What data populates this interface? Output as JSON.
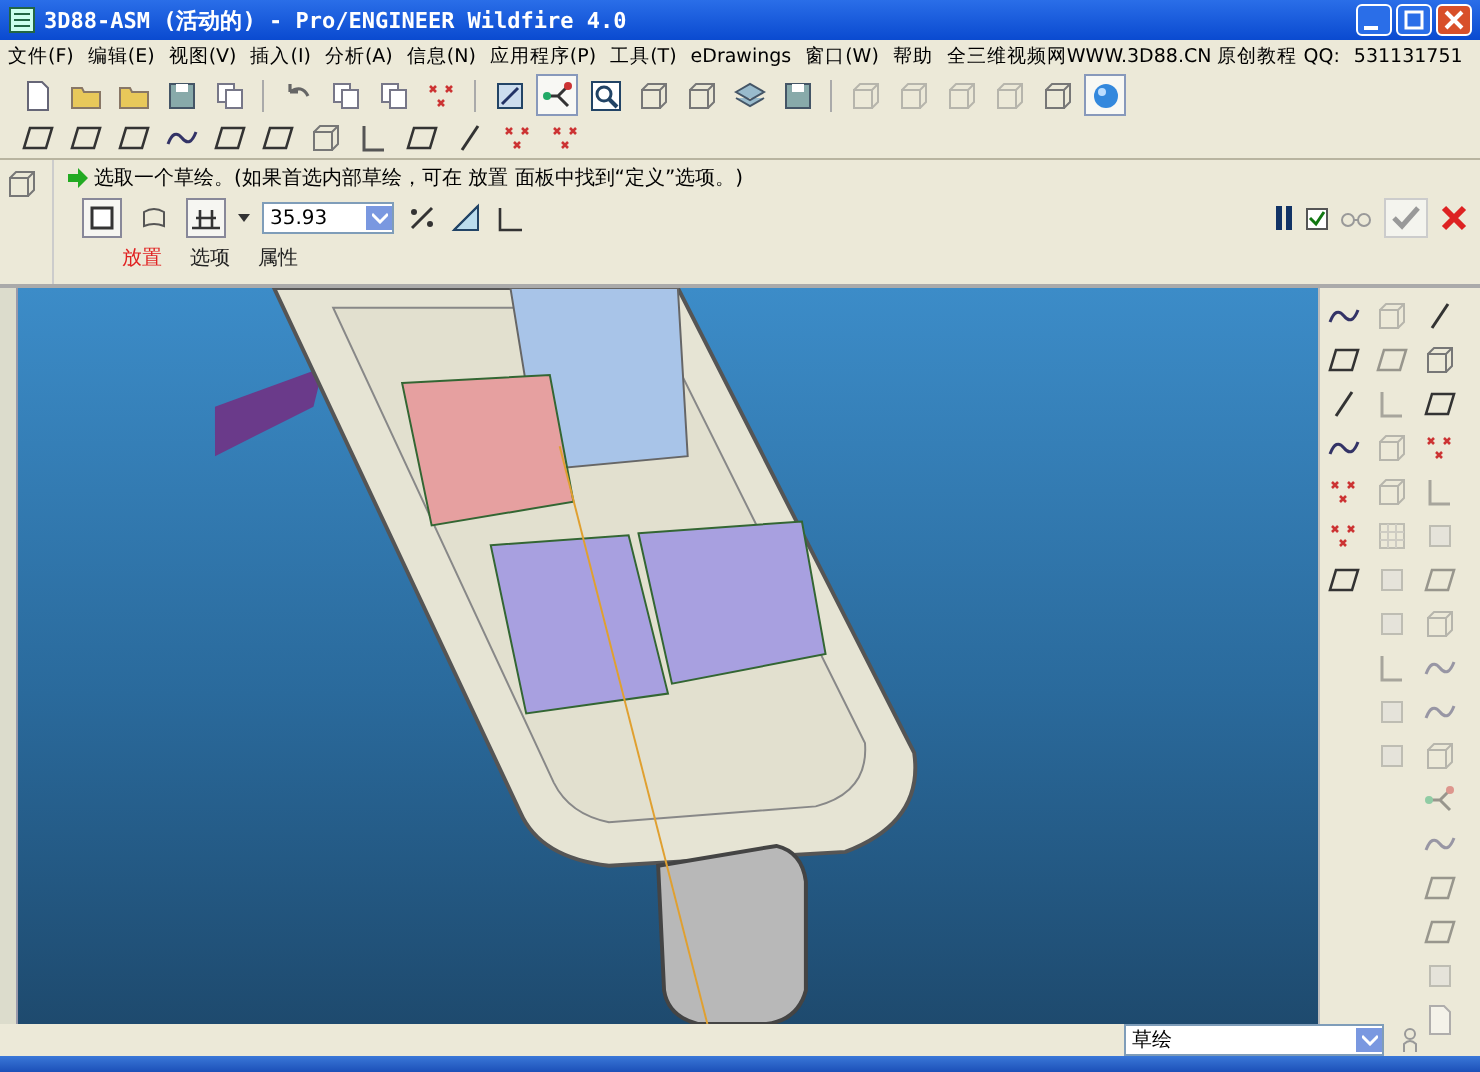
{
  "window": {
    "title": "3D88-ASM (活动的) - Pro/ENGINEER Wildfire 4.0"
  },
  "menu": [
    "文件(F)",
    "编辑(E)",
    "视图(V)",
    "插入(I)",
    "分析(A)",
    "信息(N)",
    "应用程序(P)",
    "工具(T)",
    "eDrawings",
    "窗口(W)",
    "帮助",
    "全三维视频网WWW.3D88.CN 原创教程 QQ:",
    "531131751"
  ],
  "dashboard": {
    "prompt": "选取一个草绘。(如果首选内部草绘，可在 放置 面板中找到“定义”选项。)",
    "type_buttons": [
      {
        "selected": true
      },
      {
        "selected": false
      }
    ],
    "depth_value": "35.93",
    "preview_checked": true,
    "tabs": [
      {
        "label": "放置",
        "selected": true
      },
      {
        "label": "选项",
        "selected": false
      },
      {
        "label": "属性",
        "selected": false
      }
    ]
  },
  "status_bar": {
    "filter": "草绘"
  }
}
